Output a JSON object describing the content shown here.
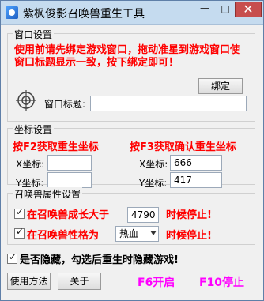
{
  "window": {
    "title": "紫枫俊影召唤兽重生工具",
    "minimize": "—",
    "maximize": "□",
    "close": "✕"
  },
  "window_settings": {
    "legend": "窗口设置",
    "instruction": "使用前请先绑定游戏窗口，拖动准星到游戏窗口使窗口标题显示一致，按下绑定即可！",
    "bind_button": "绑定",
    "window_title_label": "窗口标题:",
    "window_title_value": ""
  },
  "coords": {
    "legend": "坐标设置",
    "f2_text": "按F2获取重生坐标",
    "f3_text": "按F3获取确认重生坐标",
    "x_label_left": "X坐标:",
    "y_label_left": "Y坐标:",
    "x_value_left": "",
    "y_value_left": "",
    "x_label_right": "X坐标:",
    "y_label_right": "Y坐标:",
    "x_value_right": "666",
    "y_value_right": "417"
  },
  "summon": {
    "legend": "召唤兽属性设置",
    "growth_text": "在召唤兽成长大于",
    "growth_value": "4790",
    "growth_stop_text": "时候停止!",
    "nature_text": "在召唤兽性格为",
    "nature_value": "热血",
    "nature_stop_text": "时候停止!"
  },
  "bottom": {
    "hide_text": "是否隐藏，勾选后重生时隐藏游戏!",
    "usage_button": "使用方法",
    "about_button": "关于",
    "f6_text": "F6开启",
    "f10_text": "F10停止"
  },
  "colors": {
    "accent_red": "#ff0000",
    "accent_magenta": "#ff00ff",
    "titlebar_bg": "#c5dbef",
    "close_bg": "#c74e4e"
  },
  "icons": [
    "app-icon",
    "crosshair-icon",
    "chevron-down-icon",
    "checkmark-icon"
  ]
}
